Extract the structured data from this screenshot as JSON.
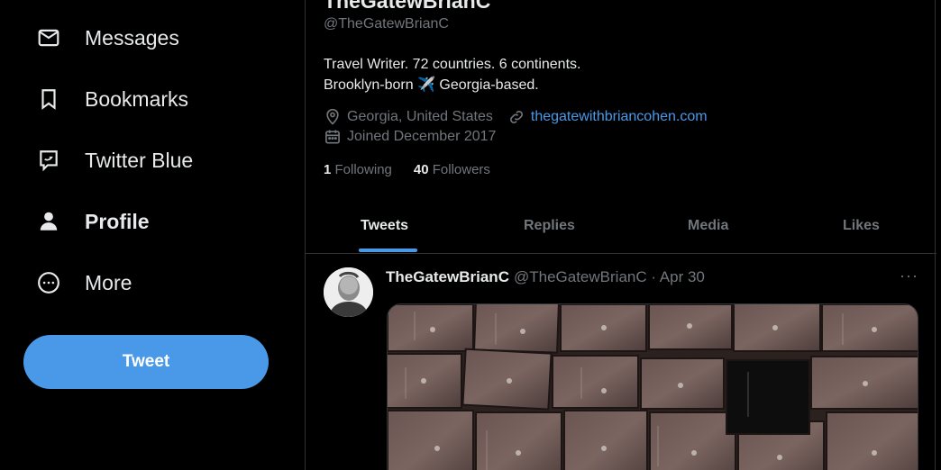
{
  "sidebar": {
    "items": [
      {
        "label": "Messages",
        "icon": "envelope-icon"
      },
      {
        "label": "Bookmarks",
        "icon": "bookmark-icon"
      },
      {
        "label": "Twitter Blue",
        "icon": "twitter-blue-icon"
      },
      {
        "label": "Profile",
        "icon": "person-icon",
        "active": true
      },
      {
        "label": "More",
        "icon": "more-circle-icon"
      }
    ],
    "tweet_button": "Tweet"
  },
  "profile": {
    "display_name": "TheGatewBrianC",
    "handle": "@TheGatewBrianC",
    "bio_line1": "Travel Writer. 72 countries. 6 continents.",
    "bio_line2": "Brooklyn-born ✈️ Georgia-based.",
    "location": "Georgia, United States",
    "website": "thegatewithbriancohen.com",
    "joined": "Joined December 2017",
    "following_count": "1",
    "following_label": "Following",
    "followers_count": "40",
    "followers_label": "Followers"
  },
  "tabs": [
    "Tweets",
    "Replies",
    "Media",
    "Likes"
  ],
  "tweet": {
    "name": "TheGatewBrianC",
    "handle_date": "@TheGatewBrianC · Apr 30",
    "more": "···"
  },
  "colors": {
    "accent": "#4a99e9",
    "background": "#000000",
    "muted": "#71767b"
  }
}
